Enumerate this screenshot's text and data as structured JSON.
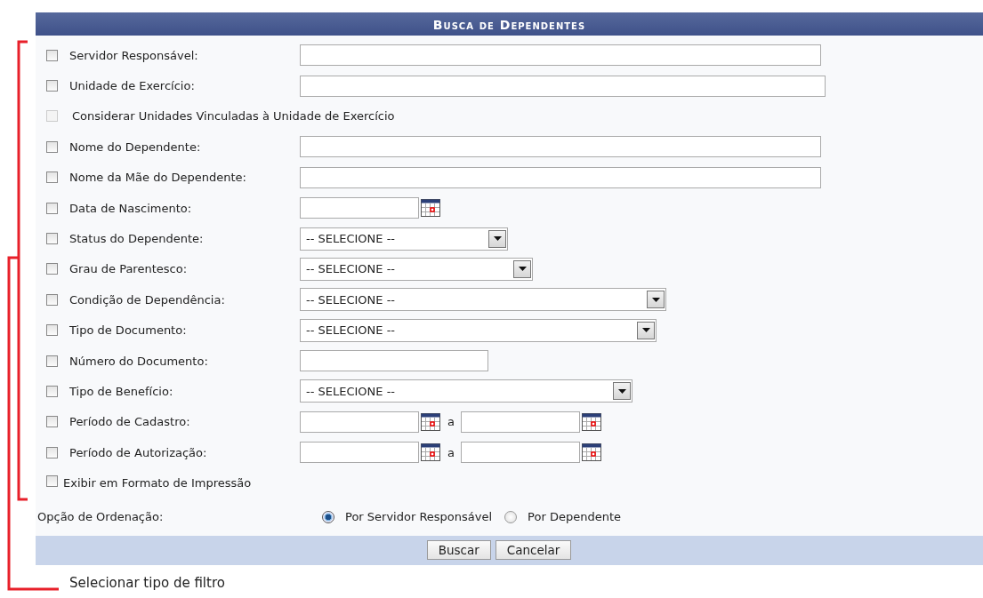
{
  "form": {
    "title": "Busca de Dependentes",
    "rows": [
      {
        "kind": "text",
        "label": "Servidor Responsável:",
        "checked": false,
        "disabled": false
      },
      {
        "kind": "text",
        "label": "Unidade de Exercício:",
        "checked": false,
        "disabled": false
      },
      {
        "kind": "option",
        "label": "Considerar Unidades Vinculadas à Unidade de Exercício",
        "checked": false,
        "disabled": true
      },
      {
        "kind": "text",
        "label": "Nome do Dependente:",
        "checked": false,
        "disabled": false
      },
      {
        "kind": "text",
        "label": "Nome da Mãe do Dependente:",
        "checked": false,
        "disabled": false
      },
      {
        "kind": "date",
        "label": "Data de Nascimento:",
        "checked": false,
        "disabled": false
      },
      {
        "kind": "select",
        "label": "Status do Dependente:",
        "value": "-- SELECIONE --",
        "checked": false,
        "disabled": false
      },
      {
        "kind": "select",
        "label": "Grau de Parentesco:",
        "value": "-- SELECIONE --",
        "checked": false,
        "disabled": false
      },
      {
        "kind": "select",
        "label": "Condição de Dependência:",
        "value": "-- SELECIONE --",
        "checked": false,
        "disabled": false
      },
      {
        "kind": "select",
        "label": "Tipo de Documento:",
        "value": "-- SELECIONE --",
        "checked": false,
        "disabled": false
      },
      {
        "kind": "text",
        "label": "Número do Documento:",
        "checked": false,
        "disabled": false
      },
      {
        "kind": "select",
        "label": "Tipo de Benefício:",
        "value": "-- SELECIONE --",
        "checked": false,
        "disabled": false
      },
      {
        "kind": "range",
        "label": "Período de Cadastro:",
        "separator": "a",
        "checked": false,
        "disabled": false
      },
      {
        "kind": "range",
        "label": "Período de Autorização:",
        "separator": "a",
        "checked": false,
        "disabled": false
      },
      {
        "kind": "print",
        "label": "Exibir em Formato de Impressão",
        "checked": false,
        "disabled": false
      }
    ],
    "sort": {
      "label": "Opção de Ordenação:",
      "options": [
        {
          "label": "Por Servidor Responsável",
          "selected": true
        },
        {
          "label": "Por Dependente",
          "selected": false
        }
      ]
    },
    "buttons": [
      "Buscar",
      "Cancelar"
    ]
  },
  "annotation": {
    "text": "Selecionar tipo de filtro"
  }
}
